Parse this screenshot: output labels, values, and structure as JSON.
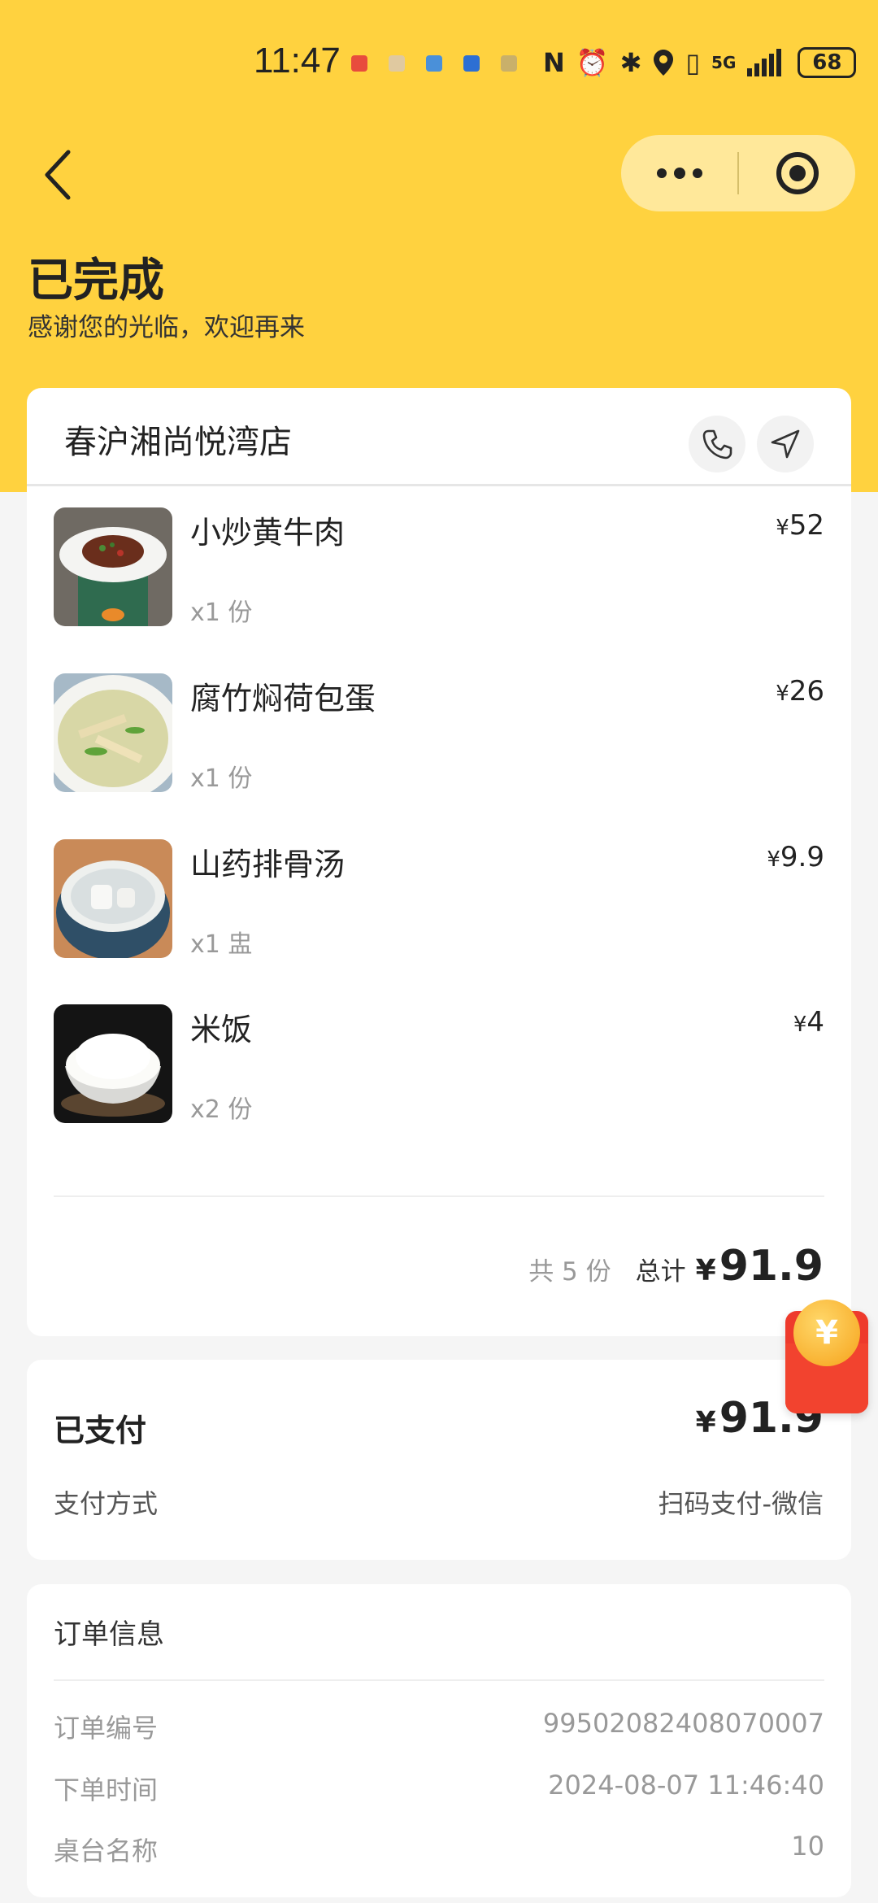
{
  "status_bar": {
    "time": "11:47",
    "network": "5G",
    "battery": "68"
  },
  "header": {
    "title": "已完成",
    "subtitle": "感谢您的光临，欢迎再来"
  },
  "store": {
    "name": "春沪湘尚悦湾店"
  },
  "items": [
    {
      "name": "小炒黄牛肉",
      "qty": "x1 份",
      "price_symbol": "¥",
      "price": "52"
    },
    {
      "name": "腐竹焖荷包蛋",
      "qty": "x1 份",
      "price_symbol": "¥",
      "price": "26"
    },
    {
      "name": "山药排骨汤",
      "qty": "x1 盅",
      "price_symbol": "¥",
      "price": "9.9"
    },
    {
      "name": "米饭",
      "qty": "x2 份",
      "price_symbol": "¥",
      "price": "4"
    }
  ],
  "summary": {
    "count": "共 5 份",
    "total_label": "总计",
    "currency": "¥",
    "total": "91.9"
  },
  "payment": {
    "status": "已支付",
    "currency": "¥",
    "amount": "91.9",
    "method_label": "支付方式",
    "method_value": "扫码支付-微信"
  },
  "order_info": {
    "title": "订单信息",
    "rows": [
      {
        "key": "订单编号",
        "value": "99502082408070007"
      },
      {
        "key": "下单时间",
        "value": "2024-08-07 11:46:40"
      },
      {
        "key": "桌台名称",
        "value": "10"
      }
    ]
  },
  "red_packet": {
    "glyph": "¥"
  },
  "colors": {
    "header_yellow": "#ffd23f",
    "capsule": "#ffe89a",
    "red_packet": "#ee3a2c"
  }
}
